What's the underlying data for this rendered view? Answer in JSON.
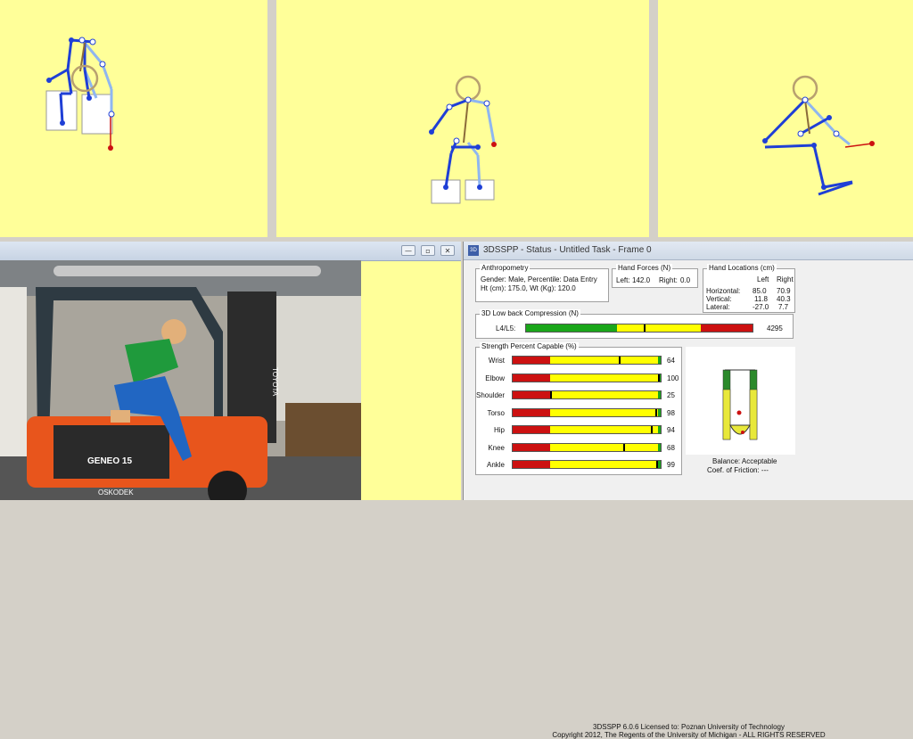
{
  "colors": {
    "view_bg": "#ffff99",
    "bone_dark": "#1f3fd6",
    "bone_light": "#8fb6f0",
    "head": "#b8a070",
    "force": "#cc1111",
    "green": "#1aa61a",
    "yellow": "#ffff00",
    "red": "#cc1111"
  },
  "photo_window": {
    "minimize_icon": "minimize-icon",
    "restore_icon": "restore-icon",
    "close_icon": "close-icon",
    "minimize_glyph": "—",
    "restore_glyph": "▫",
    "close_glyph": "✕",
    "forklift_brand": "TOYOTA",
    "forklift_model": "GENEO 15",
    "forklift_dealer": "OSKODEK"
  },
  "status_window": {
    "title": "3DSSPP - Status - Untitled Task - Frame 0",
    "app_icon_label": "3D",
    "anthropometry": {
      "title": "Anthropometry",
      "line1": "Gender: Male, Percentile: Data Entry",
      "line2": "Ht (cm): 175.0, Wt (Kg): 120.0"
    },
    "hand_forces": {
      "title": "Hand Forces (N)",
      "left_label": "Left:",
      "left_value": "142.0",
      "right_label": "Right:",
      "right_value": "0.0"
    },
    "hand_locations": {
      "title": "Hand Locations (cm)",
      "col_left": "Left",
      "col_right": "Right",
      "rows": [
        {
          "label": "Horizontal:",
          "left": "85.0",
          "right": "70.9"
        },
        {
          "label": "Vertical:",
          "left": "11.8",
          "right": "40.3"
        },
        {
          "label": "Lateral:",
          "left": "-27.0",
          "right": "7.7"
        }
      ]
    },
    "low_back": {
      "title": "3D Low back Compression (N)",
      "label": "L4/L5:",
      "value": "4295",
      "marker_fraction": 0.52
    },
    "strength": {
      "title": "Strength Percent Capable (%)",
      "rows": [
        {
          "label": "Wrist",
          "value": "64",
          "marker_fraction": 0.64
        },
        {
          "label": "Elbow",
          "value": "100",
          "marker_fraction": 1.0
        },
        {
          "label": "Shoulder",
          "value": "25",
          "marker_fraction": 0.0
        },
        {
          "label": "Torso",
          "value": "98",
          "marker_fraction": 0.98
        },
        {
          "label": "Hip",
          "value": "94",
          "marker_fraction": 0.94
        },
        {
          "label": "Knee",
          "value": "68",
          "marker_fraction": 0.68
        },
        {
          "label": "Ankle",
          "value": "99",
          "marker_fraction": 0.99
        }
      ]
    },
    "balance": {
      "label": "Balance: Acceptable",
      "friction": "Coef. of Friction: ---"
    },
    "footer_line1": "3DSSPP 6.0.6 Licensed to: Poznan University of Technology",
    "footer_line2": "Copyright 2012, The Regents of the University of Michigan - ALL RIGHTS RESERVED"
  }
}
